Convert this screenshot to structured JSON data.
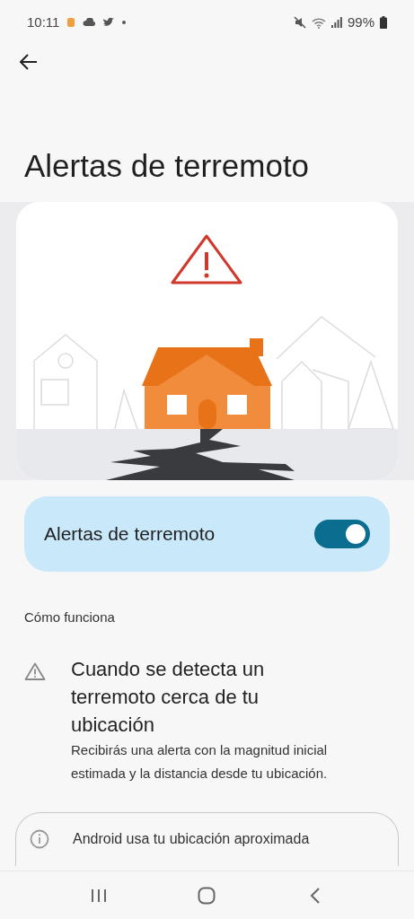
{
  "status_bar": {
    "time": "10:11",
    "battery": "99%"
  },
  "title": "Alertas de terremoto",
  "main_toggle": {
    "label": "Alertas de terremoto",
    "on": true
  },
  "section_heading": "Cómo funciona",
  "items": [
    {
      "title": "Cuando se detecta un terremoto cerca de tu ubicación",
      "description": "Recibirás una alerta con la magnitud inicial estimada y la distancia desde tu ubicación."
    }
  ],
  "info_card": {
    "text": "Android usa tu ubicación aproximada"
  }
}
